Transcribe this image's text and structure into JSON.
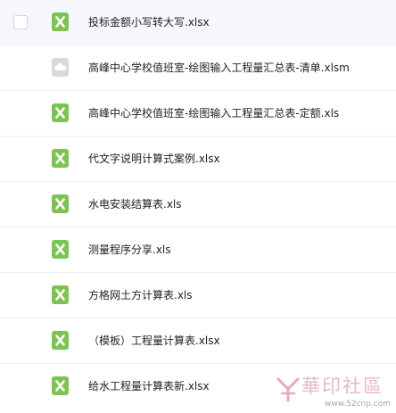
{
  "files": [
    {
      "name": "投标金额小写转大写.xlsx",
      "icon": "excel-icon",
      "highlighted": true
    },
    {
      "name": "高峰中心学校值班室-绘图输入工程量汇总表-清单.xlsm",
      "icon": "cloud-file-icon"
    },
    {
      "name": "高峰中心学校值班室-绘图输入工程量汇总表-定额.xls",
      "icon": "excel-icon"
    },
    {
      "name": "代文字说明计算式案例.xlsx",
      "icon": "excel-icon"
    },
    {
      "name": "水电安装结算表.xls",
      "icon": "excel-icon"
    },
    {
      "name": "测量程序分享.xls",
      "icon": "excel-icon"
    },
    {
      "name": "方格网土方计算表.xls",
      "icon": "excel-icon"
    },
    {
      "name": "（模板）工程量计算表.xlsx",
      "icon": "excel-icon"
    },
    {
      "name": "给水工程量计算表新.xlsx",
      "icon": "excel-icon"
    }
  ],
  "watermark": {
    "text_cn": "華印社區",
    "url": "www.52cnp.com"
  },
  "colors": {
    "excel_green": "#7cc451",
    "cloud_gray": "#d7dade",
    "row_highlight": "#f5f7fc"
  }
}
